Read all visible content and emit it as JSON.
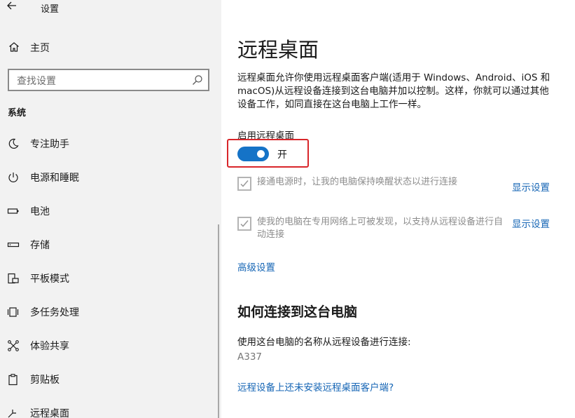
{
  "window": {
    "title": "设置"
  },
  "sidebar": {
    "home_label": "主页",
    "search_placeholder": "查找设置",
    "section_title": "系统",
    "items": [
      {
        "label": "专注助手",
        "icon": "moon-icon"
      },
      {
        "label": "电源和睡眠",
        "icon": "power-icon"
      },
      {
        "label": "电池",
        "icon": "battery-icon"
      },
      {
        "label": "存储",
        "icon": "storage-icon"
      },
      {
        "label": "平板模式",
        "icon": "tablet-mode-icon"
      },
      {
        "label": "多任务处理",
        "icon": "multitasking-icon"
      },
      {
        "label": "体验共享",
        "icon": "shared-experiences-icon"
      },
      {
        "label": "剪贴板",
        "icon": "clipboard-icon"
      },
      {
        "label": "远程桌面",
        "icon": "remote-desktop-icon"
      }
    ]
  },
  "main": {
    "title": "远程桌面",
    "description": "远程桌面允许你使用远程桌面客户端(适用于 Windows、Android、iOS 和 macOS)从远程设备连接到这台电脑并加以控制。这样，你就可以通过其他设备工作，如同直接在这台电脑上工作一样。",
    "enable_label": "启用远程桌面",
    "toggle_state": "开",
    "checkbox_1": {
      "text": "接通电源时，让我的电脑保持唤醒状态以进行连接",
      "checked": true,
      "link": "显示设置"
    },
    "checkbox_2": {
      "text": "使我的电脑在专用网络上可被发现，以支持从远程设备进行自动连接",
      "checked": true,
      "link": "显示设置"
    },
    "advanced_link": "高级设置",
    "how_to_heading": "如何连接到这台电脑",
    "use_name_text": "使用这台电脑的名称从远程设备进行连接:",
    "pc_name": "A337",
    "client_link": "远程设备上还未安装远程桌面客户端?"
  },
  "colors": {
    "accent": "#1573c7",
    "link": "#1565b5",
    "highlight_border": "#d8262a",
    "sidebar_bg": "#f2f2f2"
  }
}
